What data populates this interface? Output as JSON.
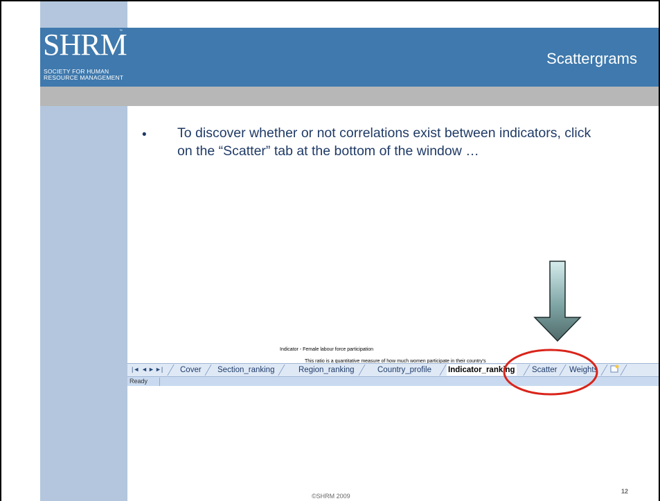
{
  "slide": {
    "title": "Scattergrams",
    "bullet": "To discover whether or not correlations exist between indicators, click on the “Scatter” tab at the bottom of the window …",
    "page_number": "12",
    "footer": "©SHRM 2009"
  },
  "logo": {
    "text": "SHRM",
    "tm": "™",
    "subtitle": "SOCIETY FOR HUMAN\nRESOURCE MANAGEMENT"
  },
  "excel": {
    "header_line_1": "Indicator - Female labour force participation",
    "header_line_2": "This ratio is a quantitative measure of how much women participate in their country's",
    "nav_buttons": [
      "|◄",
      "◄",
      "►",
      "►|"
    ],
    "tabs": [
      "Cover",
      "Section_ranking",
      "Region_ranking",
      "Country_profile",
      "Indicator_ranking",
      "Scatter",
      "Weights"
    ],
    "active_tab": "Indicator_ranking",
    "status": "Ready"
  },
  "colors": {
    "title_band": "#3f79ad",
    "left_strip": "#b3c6dd",
    "grey_band": "#b7b7b7",
    "text": "#1f3a66",
    "highlight": "#d9241a"
  },
  "icons": {
    "arrow": "down-arrow-icon",
    "new_sheet": "insert-sheet-icon"
  }
}
